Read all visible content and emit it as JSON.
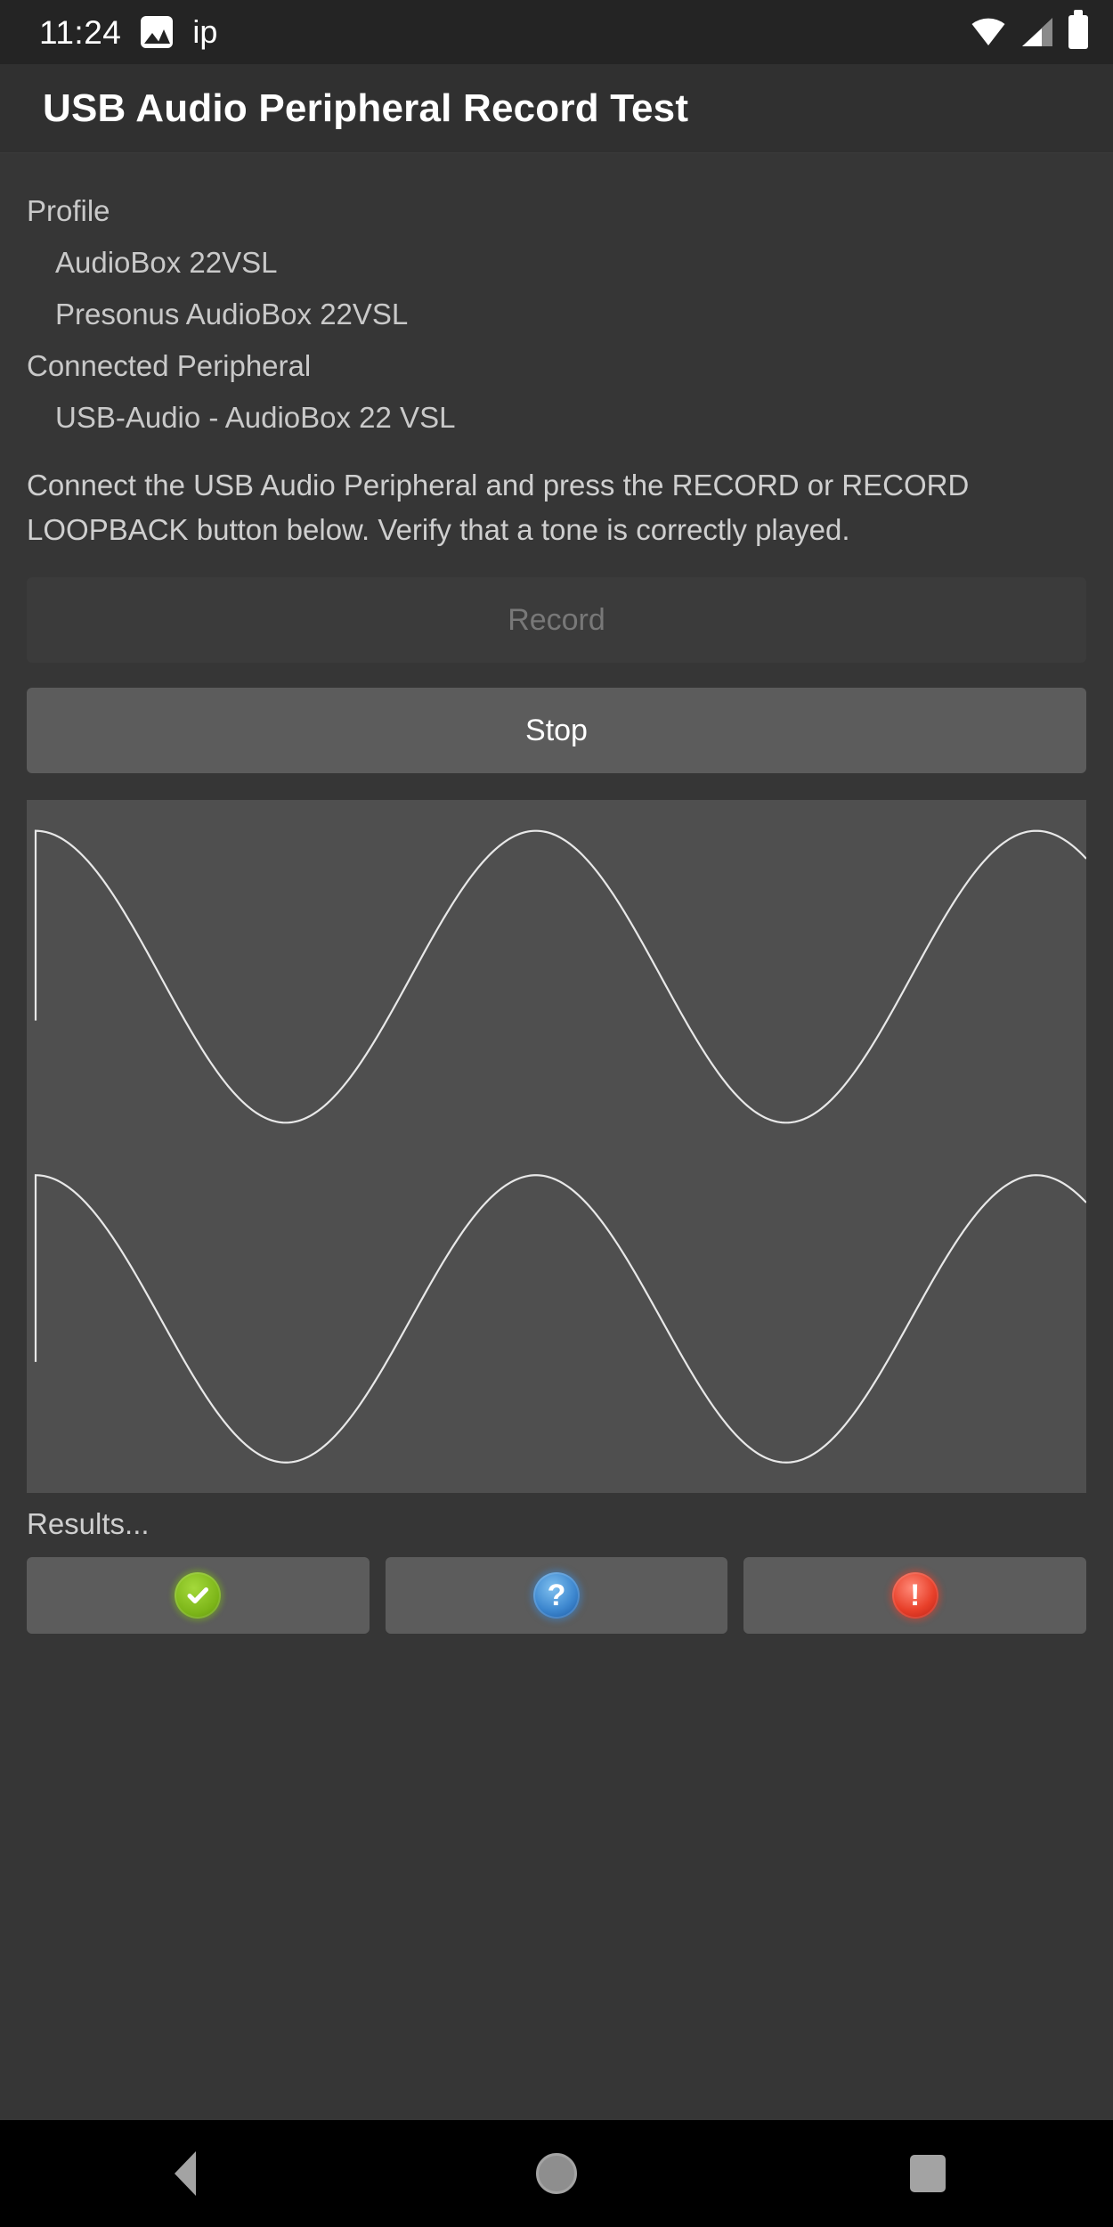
{
  "status_bar": {
    "time": "11:24",
    "notification_icon": "gallery-icon",
    "notification_label": "ip",
    "wifi_icon": "wifi-icon",
    "signal_icon": "cell-signal-icon",
    "battery_icon": "battery-icon"
  },
  "app_bar": {
    "title": "USB Audio Peripheral Record Test"
  },
  "info": {
    "profile_label": "Profile",
    "profile_name": "AudioBox 22VSL",
    "profile_product": "Presonus AudioBox 22VSL",
    "peripheral_label": "Connected Peripheral",
    "peripheral_name": "USB-Audio - AudioBox 22 VSL"
  },
  "instructions": "Connect the USB Audio Peripheral and press the RECORD or RECORD LOOPBACK button below. Verify that a tone is correctly played.",
  "buttons": {
    "record_label": "Record",
    "record_enabled": false,
    "stop_label": "Stop",
    "stop_enabled": true
  },
  "waveform": {
    "background_color": "#4f4f4f",
    "trace_color": "#e8e8e8",
    "channels": [
      {
        "name": "channel-1",
        "cycles": 2.1,
        "phase_deg": 90,
        "amplitude": 0.86
      },
      {
        "name": "channel-2",
        "cycles": 2.1,
        "phase_deg": 90,
        "amplitude": 0.86
      }
    ]
  },
  "results": {
    "label": "Results...",
    "options": [
      {
        "name": "pass",
        "icon": "check-circle-icon",
        "glyph": "✔",
        "color": "#7cb518"
      },
      {
        "name": "info",
        "icon": "question-circle-icon",
        "glyph": "?",
        "color": "#3d87cf"
      },
      {
        "name": "fail",
        "icon": "error-circle-icon",
        "glyph": "!",
        "color": "#e8402a"
      }
    ]
  },
  "nav_bar": {
    "back_icon": "back-triangle-icon",
    "home_icon": "home-circle-icon",
    "recents_icon": "recents-square-icon"
  }
}
